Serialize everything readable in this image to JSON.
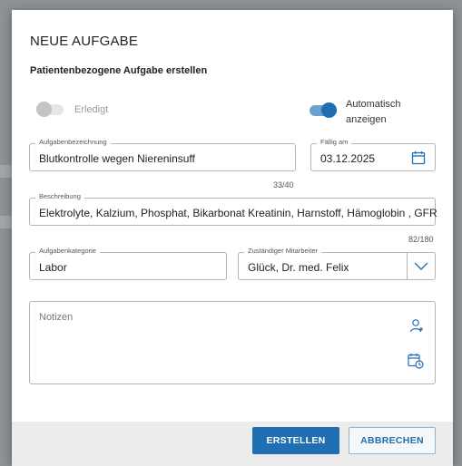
{
  "dialog": {
    "title": "NEUE AUFGABE",
    "subtitle": "Patientenbezogene Aufgabe erstellen"
  },
  "toggles": {
    "done": {
      "label": "Erledigt",
      "on": false
    },
    "auto_show": {
      "label_line1": "Automatisch",
      "label_line2": "anzeigen",
      "on": true
    }
  },
  "fields": {
    "bezeichnung": {
      "label": "Aufgabenbezeichnung",
      "value": "Blutkontrolle wegen  Niereninsuff",
      "counter": "33/40"
    },
    "faellig": {
      "label": "Fällig am",
      "value": "03.12.2025",
      "icon": "calendar-icon"
    },
    "beschreibung": {
      "label": "Beschreibung",
      "value": "Elektrolyte, Kalzium, Phosphat, Bikarbonat Kreatinin, Harnstoff, Hämoglobin , GFR",
      "counter": "82/180"
    },
    "kategorie": {
      "label": "Aufgabenkategorie",
      "value": "Labor"
    },
    "mitarbeiter": {
      "label": "Zuständiger Mitarbeiter",
      "value": "Glück, Dr. med. Felix",
      "icon": "chevron-down-icon"
    },
    "notizen": {
      "placeholder": "Notizen",
      "icons": [
        "add-person-icon",
        "calendar-clock-icon"
      ]
    }
  },
  "buttons": {
    "create": "ERSTELLEN",
    "cancel": "ABBRECHEN"
  },
  "colors": {
    "accent": "#1f6fb2",
    "overlay": "#8e9195",
    "footer": "#ececec"
  }
}
